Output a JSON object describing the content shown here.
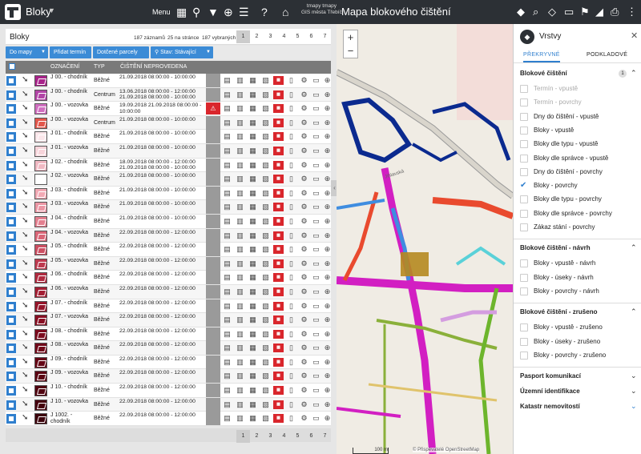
{
  "app": {
    "title": "Bloky",
    "menu_label": "Menu",
    "user_line1": "tmapy tmapy",
    "user_line2": "GIS města Třebíč",
    "map_title": "Mapa blokového čištění"
  },
  "list": {
    "title": "Bloky",
    "stats": [
      "187 záznamů",
      "25 na stránce",
      "187 vybraných"
    ],
    "pages": [
      "1",
      "2",
      "3",
      "4",
      "5",
      "6",
      "7"
    ],
    "pages_bottom": [
      "1",
      "2",
      "3",
      "4",
      "5",
      "6",
      "7"
    ],
    "buttons": {
      "to_map": "Do mapy",
      "add_term": "Přidat termín",
      "affected": "Dotčené parcely",
      "filter": "Stav: Stávající"
    },
    "columns": {
      "name": "OZNAČENÍ",
      "type": "TYP",
      "cleaning": "ČIŠTĚNÍ NEPROVEDENA"
    },
    "rows": [
      {
        "name": "J 00. - chodník",
        "type": "Běžné",
        "date": "21.09.2018   08:00:00 - 10:00:00",
        "color": "#a8238a"
      },
      {
        "name": "J 00. - chodník",
        "type": "Centrum",
        "date": "13.06.2018   08:00:00 - 12:00:00 21.09.2018   08:00:00 - 10:00:00",
        "color": "#b244a6"
      },
      {
        "name": "J 00. - vozovka",
        "type": "Běžné",
        "date": "19.09.2018 21.09.2018   08:00:00 - 10:00:00",
        "color": "#d06fc0",
        "warn": true
      },
      {
        "name": "J 00. - vozovka",
        "type": "Centrum",
        "date": "21.09.2018   08:00:00 - 10:00:00",
        "color": "#e2574c"
      },
      {
        "name": "J 01. - chodník",
        "type": "Běžné",
        "date": "21.09.2018   08:00:00 - 10:00:00",
        "color": "#fbe6ea"
      },
      {
        "name": "J 01. - vozovka",
        "type": "Běžné",
        "date": "21.09.2018   08:00:00 - 10:00:00",
        "color": "#f7d4da"
      },
      {
        "name": "J 02. - chodník",
        "type": "Běžné",
        "date": "18.09.2018   08:00:00 - 12:00:00 21.09.2018   08:00:00 - 10:00:00",
        "color": "#f0b8c2"
      },
      {
        "name": "J 02. - vozovka",
        "type": "Běžné",
        "date": "21.09.2018   08:00:00 - 10:00:00",
        "color": "#fff"
      },
      {
        "name": "J 03. - chodník",
        "type": "Běžné",
        "date": "21.09.2018   08:00:00 - 10:00:00",
        "color": "#f2a9b4"
      },
      {
        "name": "J 03. - vozovka",
        "type": "Běžné",
        "date": "21.09.2018   08:00:00 - 10:00:00",
        "color": "#eb96a4"
      },
      {
        "name": "J 04. - chodník",
        "type": "Běžné",
        "date": "21.09.2018   08:00:00 - 10:00:00",
        "color": "#e47f8f"
      },
      {
        "name": "J 04. - vozovka",
        "type": "Běžné",
        "date": "22.09.2018   08:00:00 - 12:00:00",
        "color": "#d96677"
      },
      {
        "name": "J 05. - chodník",
        "type": "Běžné",
        "date": "22.09.2018   08:00:00 - 12:00:00",
        "color": "#cc4f62"
      },
      {
        "name": "J 05. - vozovka",
        "type": "Běžné",
        "date": "22.09.2018   08:00:00 - 12:00:00",
        "color": "#be3a4f"
      },
      {
        "name": "J 06. - chodník",
        "type": "Běžné",
        "date": "22.09.2018   08:00:00 - 12:00:00",
        "color": "#b02a3f"
      },
      {
        "name": "J 06. - vozovka",
        "type": "Běžné",
        "date": "22.09.2018   08:00:00 - 12:00:00",
        "color": "#a31e33"
      },
      {
        "name": "J 07. - chodník",
        "type": "Běžné",
        "date": "22.09.2018   08:00:00 - 12:00:00",
        "color": "#95152a"
      },
      {
        "name": "J 07. - vozovka",
        "type": "Běžné",
        "date": "22.09.2018   08:00:00 - 12:00:00",
        "color": "#880f23"
      },
      {
        "name": "J 08. - chodník",
        "type": "Běžné",
        "date": "22.09.2018   08:00:00 - 12:00:00",
        "color": "#7c0b1e"
      },
      {
        "name": "J 08. - vozovka",
        "type": "Běžné",
        "date": "22.09.2018   08:00:00 - 12:00:00",
        "color": "#700819"
      },
      {
        "name": "J 09. - chodník",
        "type": "Běžné",
        "date": "22.09.2018   08:00:00 - 12:00:00",
        "color": "#650615"
      },
      {
        "name": "J 09. - vozovka",
        "type": "Běžné",
        "date": "22.09.2018   08:00:00 - 12:00:00",
        "color": "#5a0512"
      },
      {
        "name": "J 10. - chodník",
        "type": "Běžné",
        "date": "22.09.2018   08:00:00 - 12:00:00",
        "color": "#500410"
      },
      {
        "name": "J 10. - vozovka",
        "type": "Běžné",
        "date": "22.09.2018   08:00:00 - 12:00:00",
        "color": "#46030e"
      },
      {
        "name": "J 1002. - chodník",
        "type": "Běžné",
        "date": "22.09.2018   08:00:00 - 12:00:00",
        "color": "#3c030c"
      }
    ]
  },
  "map": {
    "scale": "100 m",
    "attribution": "© Přispěvatelé OpenStreetMap",
    "street": "Jihlavská"
  },
  "layers": {
    "title": "Vrstvy",
    "tabs": [
      "PŘEKRYVNÉ",
      "PODKLADOVÉ"
    ],
    "groups": [
      {
        "name": "Blokové čištění",
        "badge": "1",
        "items": [
          {
            "label": "Termín - vpustě",
            "state": "disabled"
          },
          {
            "label": "Termín - povrchy",
            "state": "disabled"
          },
          {
            "label": "Dny do čištění - vpustě",
            "state": "off"
          },
          {
            "label": "Bloky - vpustě",
            "state": "off"
          },
          {
            "label": "Bloky dle typu - vpustě",
            "state": "off"
          },
          {
            "label": "Bloky dle správce - vpustě",
            "state": "off"
          },
          {
            "label": "Dny do čištění - povrchy",
            "state": "off"
          },
          {
            "label": "Bloky - povrchy",
            "state": "on"
          },
          {
            "label": "Bloky dle typu - povrchy",
            "state": "off"
          },
          {
            "label": "Bloky dle správce - povrchy",
            "state": "off"
          },
          {
            "label": "Zákaz stání - povrchy",
            "state": "off"
          }
        ]
      },
      {
        "name": "Blokové čištění - návrh",
        "items": [
          {
            "label": "Bloky - vpustě - návrh",
            "state": "off"
          },
          {
            "label": "Bloky - úseky - návrh",
            "state": "off"
          },
          {
            "label": "Bloky - povrchy - návrh",
            "state": "off"
          }
        ]
      },
      {
        "name": "Blokové čištění - zrušeno",
        "items": [
          {
            "label": "Bloky - vpustě - zrušeno",
            "state": "off"
          },
          {
            "label": "Bloky - úseky - zrušeno",
            "state": "off"
          },
          {
            "label": "Bloky - povrchy - zrušeno",
            "state": "off"
          }
        ]
      },
      {
        "name": "Pasport komunikací",
        "items": []
      },
      {
        "name": "Územní identifikace",
        "items": []
      },
      {
        "name": "Katastr nemovitostí",
        "items": []
      }
    ]
  }
}
